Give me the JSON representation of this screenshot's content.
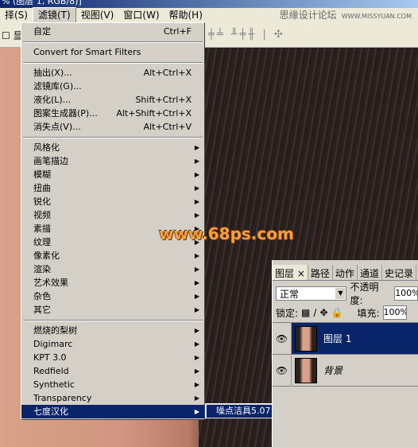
{
  "window": {
    "title": "% (图层 1, RGB/8)]"
  },
  "menubar": {
    "items": [
      "择(S)",
      "滤镜(T)",
      "视图(V)",
      "窗口(W)",
      "帮助(H)"
    ],
    "brand": "思缘设计论坛",
    "brand_url": "WWW.MISSYUAN.COM"
  },
  "toolbar": {
    "show_label": "显:"
  },
  "filter_menu": {
    "last_filter": {
      "label": "自定",
      "shortcut": "Ctrl+F"
    },
    "convert": "Convert for Smart Filters",
    "group1": [
      {
        "label": "抽出(X)...",
        "shortcut": "Alt+Ctrl+X"
      },
      {
        "label": "滤镜库(G)..."
      },
      {
        "label": "液化(L)...",
        "shortcut": "Shift+Ctrl+X"
      },
      {
        "label": "图案生成器(P)...",
        "shortcut": "Alt+Shift+Ctrl+X"
      },
      {
        "label": "消失点(V)...",
        "shortcut": "Alt+Ctrl+V"
      }
    ],
    "group2": [
      "风格化",
      "画笔描边",
      "模糊",
      "扭曲",
      "锐化",
      "视频",
      "素描",
      "纹理",
      "像素化",
      "渲染",
      "艺术效果",
      "杂色",
      "其它"
    ],
    "group3": [
      "燃烧的梨树",
      "Digimarc",
      "KPT 3.0",
      "Redfield",
      "Synthetic",
      "Transparency",
      "七度汉化"
    ],
    "highlighted": "七度汉化"
  },
  "submenu": {
    "items": [
      "噪点洁具5.07"
    ]
  },
  "watermark": "www.68ps.com",
  "layers_panel": {
    "tabs": [
      "图层",
      "路径",
      "动作",
      "通道",
      "史记录"
    ],
    "blend_mode": "正常",
    "opacity_label": "不透明度:",
    "opacity": "100%",
    "lock_label": "锁定:",
    "fill_label": "填充:",
    "fill": "100%",
    "layers": [
      {
        "name": "图层 1",
        "selected": true
      },
      {
        "name": "背景",
        "selected": false
      }
    ]
  }
}
